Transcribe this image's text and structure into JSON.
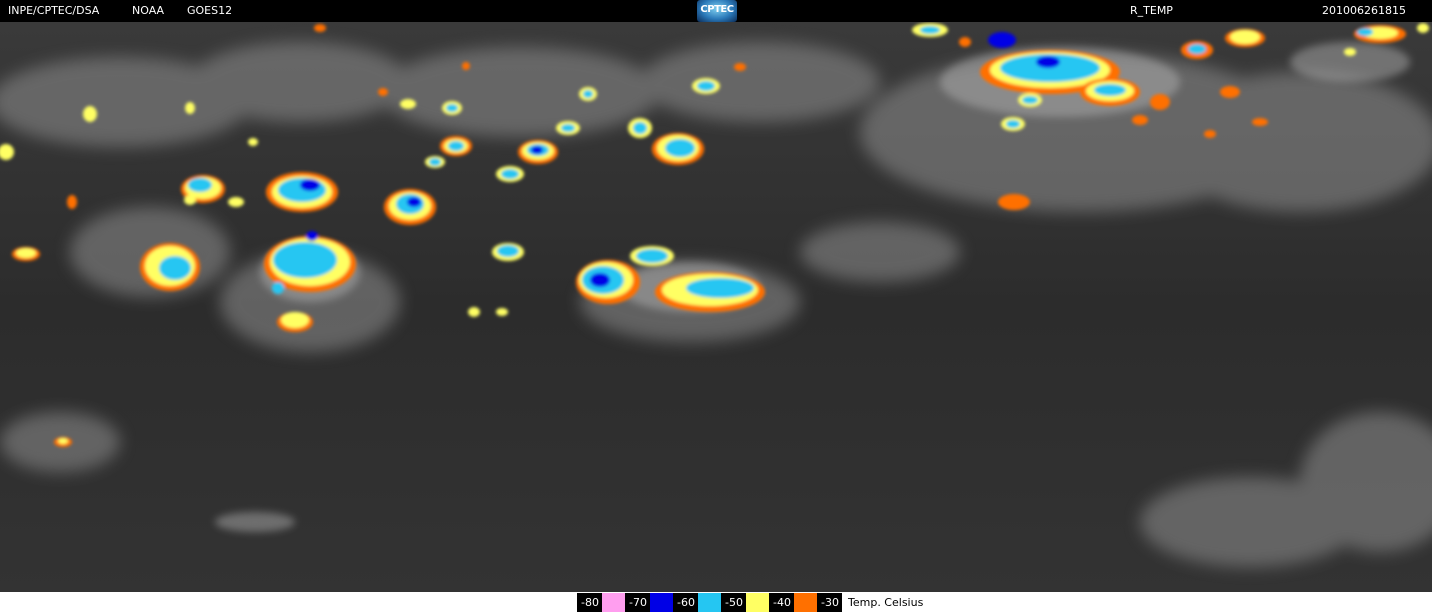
{
  "header": {
    "org": "INPE/CPTEC/DSA",
    "agency": "NOAA",
    "satellite": "GOES12",
    "logo_text": "CPTEC",
    "product": "R_TEMP",
    "timestamp": "201006261815"
  },
  "legend": {
    "items": [
      {
        "label": "-80",
        "color": "#ff9eef"
      },
      {
        "label": "-70",
        "color": "#0000e6"
      },
      {
        "label": "-60",
        "color": "#25c6f2"
      },
      {
        "label": "-50",
        "color": "#ffff63"
      },
      {
        "label": "-40",
        "color": "#ff7000"
      },
      {
        "label": "-30",
        "color": ""
      }
    ],
    "unit": "Temp. Celsius"
  },
  "colors": {
    "background_ir": "#2e2e2e",
    "cloud_gray": "#9a9a9a"
  }
}
